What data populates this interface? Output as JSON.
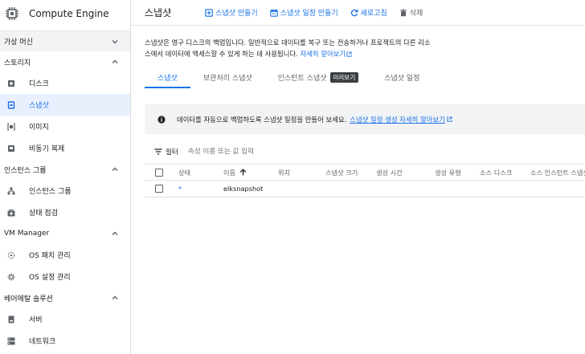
{
  "sidebar": {
    "product_title": "Compute Engine",
    "sections": [
      {
        "label": "가상 머신",
        "state": "collapsed",
        "items": []
      },
      {
        "label": "스토리지",
        "state": "expanded",
        "items": [
          {
            "label": "디스크",
            "icon": "disk-icon",
            "active": false
          },
          {
            "label": "스냅샷",
            "icon": "snapshot-icon",
            "active": true
          },
          {
            "label": "이미지",
            "icon": "image-icon",
            "active": false
          },
          {
            "label": "비동기 복제",
            "icon": "async-replication-icon",
            "active": false
          }
        ]
      },
      {
        "label": "인스턴스 그룹",
        "state": "expanded",
        "items": [
          {
            "label": "인스턴스 그룹",
            "icon": "instance-group-icon",
            "active": false
          },
          {
            "label": "상태 점검",
            "icon": "health-check-icon",
            "active": false
          }
        ]
      },
      {
        "label": "VM Manager",
        "state": "expanded",
        "items": [
          {
            "label": "OS 패치 관리",
            "icon": "os-patch-icon",
            "active": false
          },
          {
            "label": "OS 설정 관리",
            "icon": "os-config-icon",
            "active": false
          }
        ]
      },
      {
        "label": "베어메탈 솔루션",
        "state": "expanded",
        "items": [
          {
            "label": "서버",
            "icon": "server-icon",
            "active": false
          },
          {
            "label": "네트워크",
            "icon": "network-icon",
            "active": false
          }
        ]
      }
    ]
  },
  "toolbar": {
    "title": "스냅샷",
    "create_snapshot": "스냅샷 만들기",
    "create_schedule": "스냅샷 일정 만들기",
    "refresh": "새로고침",
    "delete": "삭제"
  },
  "description": {
    "text": "스냅샷은 영구 디스크의 백업입니다. 일반적으로 데이터를 복구 또는 전송하거나 프로젝트의 다른 리소스에서 데이터에 액세스할 수 있게 하는 데 사용됩니다.",
    "link": "자세히 알아보기"
  },
  "tabs": [
    {
      "label": "스냅샷",
      "active": true
    },
    {
      "label": "보관처리 스냅샷",
      "active": false
    },
    {
      "label": "인스턴트 스냅샷",
      "active": false,
      "badge": "미리보기"
    },
    {
      "label": "스냅샷 일정",
      "active": false
    }
  ],
  "banner": {
    "text": "데이터를 자동으로 백업하도록 스냅샷 일정을 만들어 보세요.",
    "link": "스냅샷 일정 생성 자세히 알아보기"
  },
  "filter": {
    "label": "필터",
    "placeholder": "속성 이름 또는 값 입력"
  },
  "table": {
    "columns": {
      "status": "상태",
      "name": "이름",
      "location": "위치",
      "size": "스냅샷 크기",
      "created": "생성 시간",
      "creation_type": "생성 유형",
      "source_disk": "소스 디스크",
      "source_instance": "소스 인스턴트 스냅샷"
    },
    "rows": [
      {
        "status": "*",
        "name": "elksnapshot",
        "location": "",
        "size": "",
        "created": "",
        "creation_type": "",
        "source_disk": "",
        "source_instance": ""
      }
    ]
  },
  "colors": {
    "accent": "#1a73e8",
    "active_bg": "#e8f0fe",
    "banner_bg": "#f1f3f4",
    "border": "#dadce0"
  }
}
